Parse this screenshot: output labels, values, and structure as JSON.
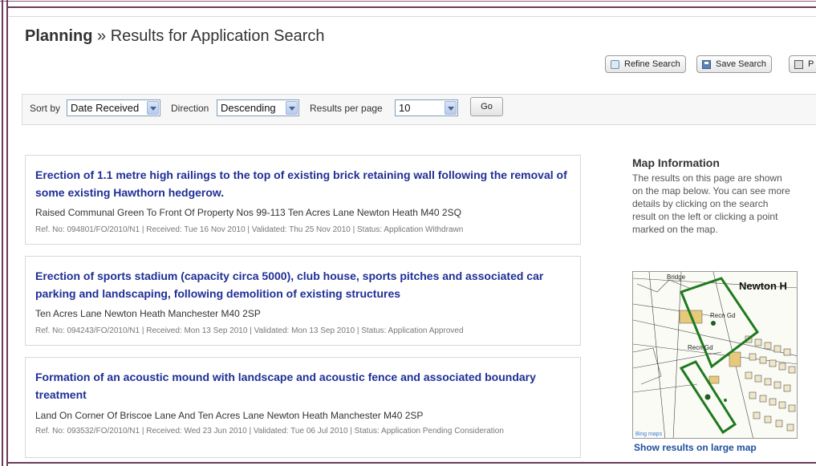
{
  "header": {
    "section": "Planning",
    "separator": " » ",
    "subtitle": "Results for Application Search"
  },
  "toolbar": {
    "refine_label": "Refine Search",
    "save_label": "Save Search",
    "print_label": "P"
  },
  "sort": {
    "sort_by_label": "Sort by",
    "sort_by_value": "Date Received",
    "direction_label": "Direction",
    "direction_value": "Descending",
    "per_page_label": "Results per page",
    "per_page_value": "10",
    "go_label": "Go"
  },
  "results": [
    {
      "title": "Erection of 1.1 metre high railings to the top of existing brick retaining wall following the removal of some existing Hawthorn hedgerow.",
      "address": "Raised Communal Green To Front Of Property Nos 99-113 Ten Acres Lane Newton Heath M40 2SQ",
      "meta": "Ref. No: 094801/FO/2010/N1 | Received: Tue 16 Nov 2010 | Validated: Thu 25 Nov 2010 | Status: Application Withdrawn"
    },
    {
      "title": "Erection of sports stadium (capacity circa 5000), club house, sports pitches and associated car parking and landscaping, following demolition of existing structures",
      "address": "Ten Acres Lane Newton Heath Manchester M40 2SP",
      "meta": "Ref. No: 094243/FO/2010/N1 | Received: Mon 13 Sep 2010 | Validated: Mon 13 Sep 2010 | Status: Application Approved"
    },
    {
      "title": "Formation of an acoustic mound with landscape and acoustic fence and associated boundary treatment",
      "address": "Land On Corner Of Briscoe Lane And Ten Acres Lane Newton Heath Manchester M40 2SP",
      "meta": "Ref. No: 093532/FO/2010/N1 | Received: Wed 23 Jun 2010 | Validated: Tue 06 Jul 2010 | Status: Application Pending Consideration"
    }
  ],
  "map_info": {
    "title": "Map Information",
    "text": "The results on this page are shown on the map below. You can see more details by clicking on the search result on the left or clicking a point marked on the map.",
    "map_label_1": "Bridge",
    "map_label_2": "Newton H",
    "map_label_3": "Recn Gd",
    "map_label_4": "Recn Gd",
    "map_credit": "Bing maps",
    "link_label": "Show results on large map"
  }
}
